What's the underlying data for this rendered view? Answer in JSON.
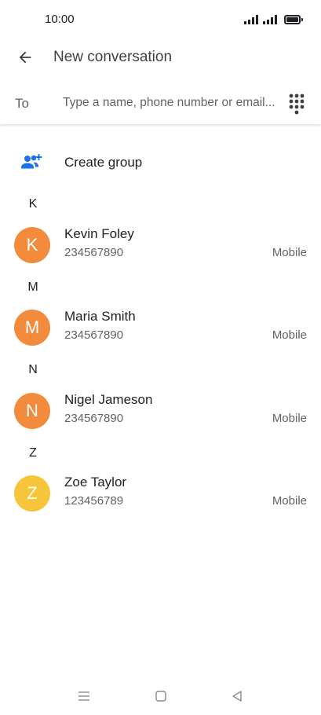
{
  "status_bar": {
    "time": "10:00"
  },
  "app_bar": {
    "title": "New conversation",
    "back_icon": "arrow-back-icon"
  },
  "to_row": {
    "label": "To",
    "placeholder": "Type a name, phone number or email...",
    "dialpad_icon": "dialpad-icon"
  },
  "create_group": {
    "label": "Create group",
    "icon": "group-add-icon"
  },
  "sections": [
    {
      "letter": "K",
      "contacts": [
        {
          "initial": "K",
          "name": "Kevin Foley",
          "number": "234567890",
          "type": "Mobile",
          "color": "#f28b3b"
        }
      ]
    },
    {
      "letter": "M",
      "contacts": [
        {
          "initial": "M",
          "name": "Maria Smith",
          "number": "234567890",
          "type": "Mobile",
          "color": "#f28b3b"
        }
      ]
    },
    {
      "letter": "N",
      "contacts": [
        {
          "initial": "N",
          "name": "Nigel Jameson",
          "number": "234567890",
          "type": "Mobile",
          "color": "#f28b3b"
        }
      ]
    },
    {
      "letter": "Z",
      "contacts": [
        {
          "initial": "Z",
          "name": "Zoe Taylor",
          "number": "123456789",
          "type": "Mobile",
          "color": "#f6c53a"
        }
      ]
    }
  ],
  "nav_bar": {
    "menu_icon": "menu-icon",
    "home_icon": "home-icon",
    "back_icon": "nav-back-icon"
  },
  "colors": {
    "accent": "#1a73e8",
    "orange_avatar": "#f28b3b",
    "yellow_avatar": "#f6c53a"
  }
}
